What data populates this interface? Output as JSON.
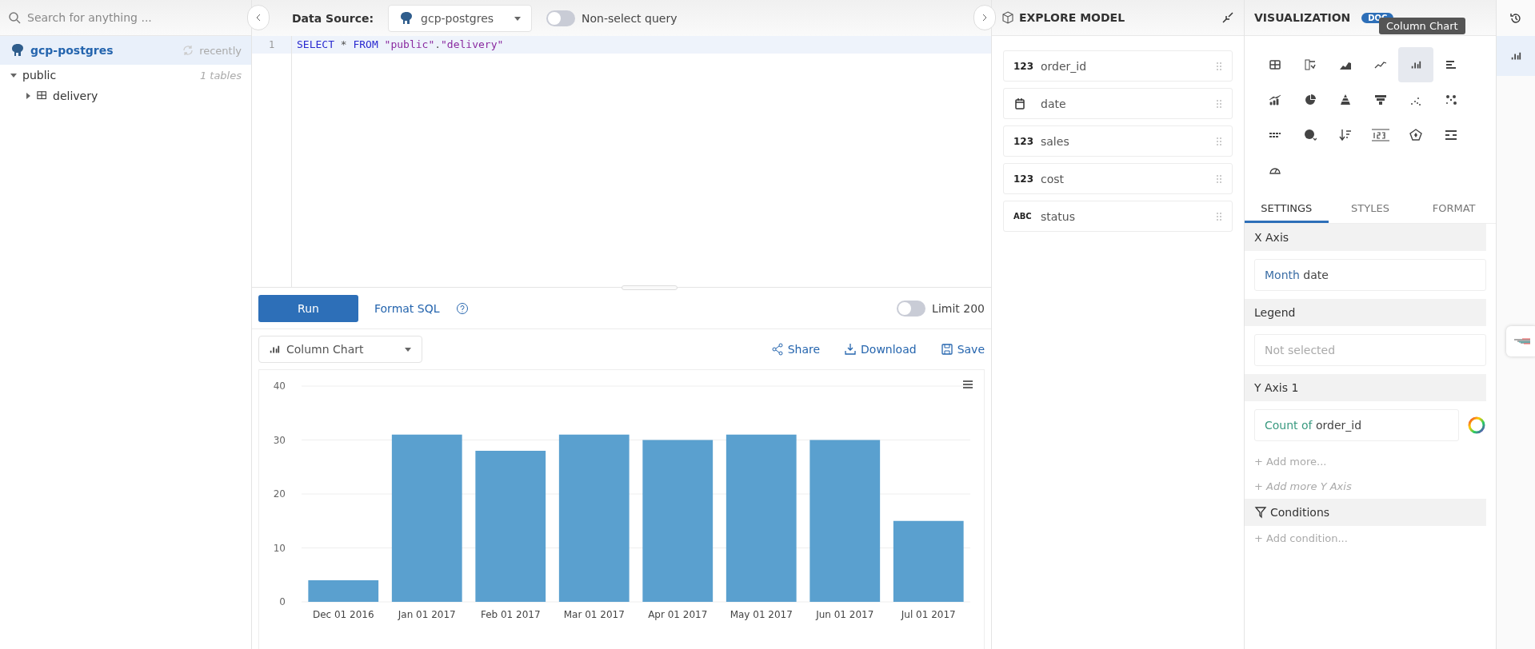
{
  "search": {
    "placeholder": "Search for anything ..."
  },
  "datasource_tree": {
    "name": "gcp-postgres",
    "status": "recently",
    "schemas": [
      {
        "name": "public",
        "count": "1 tables",
        "expanded": true,
        "children": [
          {
            "name": "delivery",
            "expanded": false
          }
        ]
      }
    ]
  },
  "editor": {
    "data_source_label": "Data Source:",
    "data_source": "gcp-postgres",
    "non_select_toggle": {
      "label": "Non-select query",
      "on": false
    },
    "lines": [
      {
        "number": "1",
        "tokens": [
          {
            "kind": "keyword",
            "text": "SELECT "
          },
          {
            "kind": "operator",
            "text": "* "
          },
          {
            "kind": "keyword",
            "text": "FROM "
          },
          {
            "kind": "string",
            "text": "\"public\""
          },
          {
            "kind": "operator",
            "text": "."
          },
          {
            "kind": "string",
            "text": "\"delivery\""
          }
        ]
      }
    ]
  },
  "run_bar": {
    "run": "Run",
    "format": "Format SQL",
    "limit_toggle": {
      "label": "Limit 200",
      "on": false
    }
  },
  "result": {
    "chart_type": "Column Chart",
    "actions": [
      "Share",
      "Download",
      "Save"
    ],
    "chart_data": {
      "type": "bar",
      "categories": [
        "Dec 01 2016",
        "Jan 01 2017",
        "Feb 01 2017",
        "Mar 01 2017",
        "Apr 01 2017",
        "May 01 2017",
        "Jun 01 2017",
        "Jul 01 2017"
      ],
      "series": [
        {
          "color": "#5aa0cf",
          "values": [
            4,
            31,
            28,
            31,
            30,
            31,
            30,
            15
          ]
        }
      ],
      "grid": true,
      "ylim": [
        0,
        40
      ],
      "yticks": [
        0,
        10,
        20,
        30,
        40
      ]
    }
  },
  "explore_model": {
    "title": "EXPLORE MODEL",
    "fields": [
      {
        "kind": "number",
        "badge": "123",
        "name": "order_id"
      },
      {
        "kind": "date",
        "name": "date"
      },
      {
        "kind": "number",
        "badge": "123",
        "name": "sales"
      },
      {
        "kind": "number",
        "badge": "123",
        "name": "cost"
      },
      {
        "kind": "text",
        "badge": "ABC",
        "name": "status"
      }
    ]
  },
  "visualization": {
    "title": "VISUALIZATION",
    "docs_badge": "DOC",
    "tooltip": "Column Chart",
    "chart_types": [
      {
        "kind": "table",
        "selected": false
      },
      {
        "kind": "pivot",
        "selected": false
      },
      {
        "kind": "area",
        "selected": false
      },
      {
        "kind": "line",
        "selected": false
      },
      {
        "kind": "column",
        "selected": true
      },
      {
        "kind": "bar",
        "selected": false
      },
      {
        "kind": "combo",
        "selected": false
      },
      {
        "kind": "pie",
        "selected": false
      },
      {
        "kind": "pyramid",
        "selected": false
      },
      {
        "kind": "funnel",
        "selected": false
      },
      {
        "kind": "scatter",
        "selected": false
      },
      {
        "kind": "bubble",
        "selected": false
      },
      {
        "kind": "heatmap",
        "selected": false
      },
      {
        "kind": "map",
        "selected": false
      },
      {
        "kind": "sort",
        "selected": false
      },
      {
        "kind": "number",
        "selected": false
      },
      {
        "kind": "radar",
        "selected": false
      },
      {
        "kind": "divider",
        "selected": false
      },
      {
        "kind": "gauge",
        "selected": false
      }
    ],
    "tabs": [
      {
        "label": "SETTINGS",
        "selected": true
      },
      {
        "label": "STYLES",
        "selected": false
      },
      {
        "label": "FORMAT",
        "selected": false
      }
    ],
    "x_axis": {
      "label": "X Axis",
      "prefix": "Month",
      "field": "date"
    },
    "legend": {
      "label": "Legend",
      "placeholder": "Not selected"
    },
    "y_axis": {
      "label": "Y Axis 1",
      "prefix": "Count of",
      "field": "order_id",
      "add_more": "+ Add more..."
    },
    "add_y_axis": "+ Add more Y Axis",
    "conditions": {
      "label": "Conditions",
      "add": "+ Add condition..."
    }
  }
}
